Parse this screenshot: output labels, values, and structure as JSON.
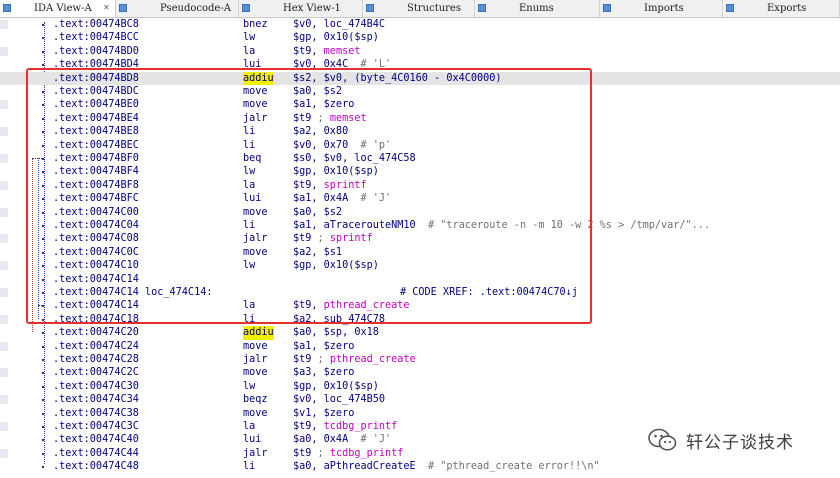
{
  "tabs": [
    {
      "label": "IDA View-A",
      "active": true
    },
    {
      "label": "Pseudocode-A",
      "active": false
    },
    {
      "label": "Hex View-1",
      "active": false
    },
    {
      "label": "Structures",
      "active": false
    },
    {
      "label": "Enums",
      "active": false
    },
    {
      "label": "Imports",
      "active": false
    },
    {
      "label": "Exports",
      "active": false
    }
  ],
  "lines": [
    {
      "addr": ".text:00474BC8",
      "label": "",
      "mnem": "bnez",
      "ops": [
        {
          "t": "$v0, loc_474B4C",
          "c": "n"
        }
      ]
    },
    {
      "addr": ".text:00474BCC",
      "label": "",
      "mnem": "lw",
      "ops": [
        {
          "t": "$gp, 0x10($sp)",
          "c": "n"
        }
      ]
    },
    {
      "addr": ".text:00474BD0",
      "label": "",
      "mnem": "la",
      "ops": [
        {
          "t": "$t9, ",
          "c": "n"
        },
        {
          "t": "memset",
          "c": "f"
        }
      ]
    },
    {
      "addr": ".text:00474BD4",
      "label": "",
      "mnem": "lui",
      "ops": [
        {
          "t": "$v0, 0x4C  ",
          "c": "n"
        },
        {
          "t": "# 'L'",
          "c": "c"
        }
      ]
    },
    {
      "addr": ".text:00474BD8",
      "label": "",
      "mnem": "addiu",
      "mnemHl": true,
      "rowHl": true,
      "ops": [
        {
          "t": "$s2, $v0, (byte_4C0160 - 0x4C0000)",
          "c": "n"
        }
      ]
    },
    {
      "addr": ".text:00474BDC",
      "label": "",
      "mnem": "move",
      "ops": [
        {
          "t": "$a0, $s2",
          "c": "n"
        }
      ]
    },
    {
      "addr": ".text:00474BE0",
      "label": "",
      "mnem": "move",
      "ops": [
        {
          "t": "$a1, $zero",
          "c": "n"
        }
      ]
    },
    {
      "addr": ".text:00474BE4",
      "label": "",
      "mnem": "jalr",
      "ops": [
        {
          "t": "$t9 ",
          "c": "n"
        },
        {
          "t": "; ",
          "c": "c"
        },
        {
          "t": "memset",
          "c": "f"
        }
      ]
    },
    {
      "addr": ".text:00474BE8",
      "label": "",
      "mnem": "li",
      "ops": [
        {
          "t": "$a2, 0x80",
          "c": "n"
        }
      ]
    },
    {
      "addr": ".text:00474BEC",
      "label": "",
      "mnem": "li",
      "ops": [
        {
          "t": "$v0, 0x70  ",
          "c": "n"
        },
        {
          "t": "# 'p'",
          "c": "c"
        }
      ]
    },
    {
      "addr": ".text:00474BF0",
      "label": "",
      "mnem": "beq",
      "ops": [
        {
          "t": "$s0, $v0, loc_474C58",
          "c": "n"
        }
      ]
    },
    {
      "addr": ".text:00474BF4",
      "label": "",
      "mnem": "lw",
      "ops": [
        {
          "t": "$gp, 0x10($sp)",
          "c": "n"
        }
      ]
    },
    {
      "addr": ".text:00474BF8",
      "label": "",
      "mnem": "la",
      "ops": [
        {
          "t": "$t9, ",
          "c": "n"
        },
        {
          "t": "sprintf",
          "c": "f"
        }
      ]
    },
    {
      "addr": ".text:00474BFC",
      "label": "",
      "mnem": "lui",
      "ops": [
        {
          "t": "$a1, 0x4A  ",
          "c": "n"
        },
        {
          "t": "# 'J'",
          "c": "c"
        }
      ]
    },
    {
      "addr": ".text:00474C00",
      "label": "",
      "mnem": "move",
      "ops": [
        {
          "t": "$a0, $s2",
          "c": "n"
        }
      ]
    },
    {
      "addr": ".text:00474C04",
      "label": "",
      "mnem": "li",
      "ops": [
        {
          "t": "$a1, aTracerouteNM10  ",
          "c": "n"
        },
        {
          "t": "# \"traceroute -n -m 10 -w 2 %s > /tmp/var/\"...",
          "c": "c"
        }
      ]
    },
    {
      "addr": ".text:00474C08",
      "label": "",
      "mnem": "jalr",
      "ops": [
        {
          "t": "$t9 ",
          "c": "n"
        },
        {
          "t": "; ",
          "c": "c"
        },
        {
          "t": "sprintf",
          "c": "f"
        }
      ]
    },
    {
      "addr": ".text:00474C0C",
      "label": "",
      "mnem": "move",
      "ops": [
        {
          "t": "$a2, $s1",
          "c": "n"
        }
      ]
    },
    {
      "addr": ".text:00474C10",
      "label": "",
      "mnem": "lw",
      "ops": [
        {
          "t": "$gp, 0x10($sp)",
          "c": "n"
        }
      ]
    },
    {
      "addr": ".text:00474C14",
      "label": "",
      "mnem": "",
      "ops": []
    },
    {
      "addr": ".text:00474C14",
      "label": "loc_474C14:",
      "mnem": "",
      "ops": [],
      "xref": "# CODE XREF: .text:00474C70↓j"
    },
    {
      "addr": ".text:00474C14",
      "label": "",
      "mnem": "la",
      "ops": [
        {
          "t": "$t9, ",
          "c": "n"
        },
        {
          "t": "pthread_create",
          "c": "f"
        }
      ]
    },
    {
      "addr": ".text:00474C18",
      "label": "",
      "mnem": "li",
      "ops": [
        {
          "t": "$a2, sub_474C78",
          "c": "n"
        }
      ]
    },
    {
      "addr": ".text:00474C20",
      "label": "",
      "mnem": "addiu",
      "mnemHl": true,
      "ops": [
        {
          "t": "$a0, $sp, 0x18",
          "c": "n"
        }
      ]
    },
    {
      "addr": ".text:00474C24",
      "label": "",
      "mnem": "move",
      "ops": [
        {
          "t": "$a1, $zero",
          "c": "n"
        }
      ]
    },
    {
      "addr": ".text:00474C28",
      "label": "",
      "mnem": "jalr",
      "ops": [
        {
          "t": "$t9 ",
          "c": "n"
        },
        {
          "t": "; ",
          "c": "c"
        },
        {
          "t": "pthread_create",
          "c": "f"
        }
      ]
    },
    {
      "addr": ".text:00474C2C",
      "label": "",
      "mnem": "move",
      "ops": [
        {
          "t": "$a3, $zero",
          "c": "n"
        }
      ]
    },
    {
      "addr": ".text:00474C30",
      "label": "",
      "mnem": "lw",
      "ops": [
        {
          "t": "$gp, 0x10($sp)",
          "c": "n"
        }
      ]
    },
    {
      "addr": ".text:00474C34",
      "label": "",
      "mnem": "beqz",
      "ops": [
        {
          "t": "$v0, loc_474B50",
          "c": "n"
        }
      ]
    },
    {
      "addr": ".text:00474C38",
      "label": "",
      "mnem": "move",
      "ops": [
        {
          "t": "$v1, $zero",
          "c": "n"
        }
      ]
    },
    {
      "addr": ".text:00474C3C",
      "label": "",
      "mnem": "la",
      "ops": [
        {
          "t": "$t9, ",
          "c": "n"
        },
        {
          "t": "tcdbg_printf",
          "c": "f"
        }
      ]
    },
    {
      "addr": ".text:00474C40",
      "label": "",
      "mnem": "lui",
      "ops": [
        {
          "t": "$a0, 0x4A  ",
          "c": "n"
        },
        {
          "t": "# 'J'",
          "c": "c"
        }
      ]
    },
    {
      "addr": ".text:00474C44",
      "label": "",
      "mnem": "jalr",
      "ops": [
        {
          "t": "$t9 ",
          "c": "n"
        },
        {
          "t": "; ",
          "c": "c"
        },
        {
          "t": "tcdbg_printf",
          "c": "f"
        }
      ]
    },
    {
      "addr": ".text:00474C48",
      "label": "",
      "mnem": "li",
      "ops": [
        {
          "t": "$a0, aPthreadCreateE  ",
          "c": "n"
        },
        {
          "t": "# \"pthread_create error!!\\n\"",
          "c": "c"
        }
      ]
    }
  ],
  "watermark": {
    "text": "轩公子谈技术",
    "icon": "wechat-icon"
  },
  "colors": {
    "annotation_box": "#e53030",
    "mnemonic_highlight": "#f0f000",
    "function_name": "#c000c0",
    "code": "#000080"
  }
}
